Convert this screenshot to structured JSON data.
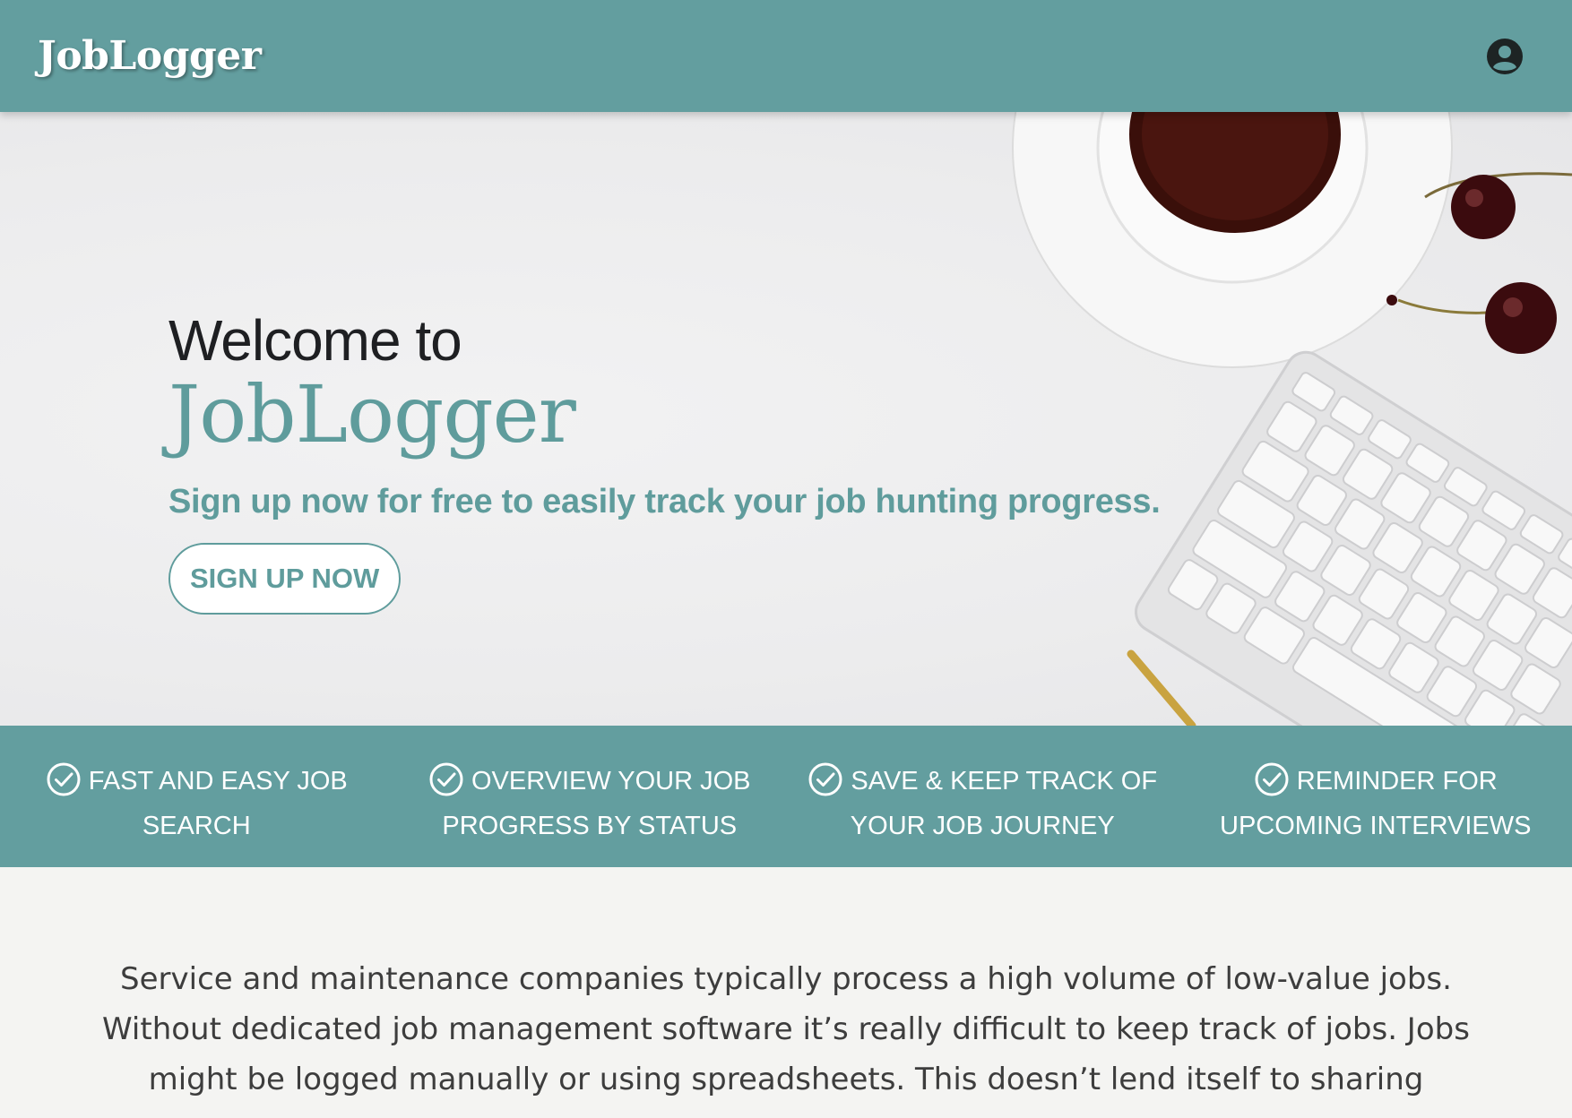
{
  "header": {
    "brand": "JobLogger",
    "account_icon": "account-circle-icon"
  },
  "hero": {
    "welcome": "Welcome to",
    "brand": "JobLogger",
    "tagline": "Sign up now for free to easily track your job hunting progress.",
    "signup_label": "SIGN UP NOW"
  },
  "features": [
    {
      "line1": "FAST AND EASY JOB",
      "line2": "SEARCH",
      "icon": "check-circle-icon"
    },
    {
      "line1": "OVERVIEW YOUR JOB",
      "line2": "PROGRESS BY STATUS",
      "icon": "check-circle-icon"
    },
    {
      "line1": "SAVE & KEEP TRACK OF",
      "line2": "YOUR JOB JOURNEY",
      "icon": "check-circle-icon"
    },
    {
      "line1": "REMINDER FOR",
      "line2": "UPCOMING INTERVIEWS",
      "icon": "check-circle-icon"
    }
  ],
  "intro": {
    "line1": "Service and maintenance companies typically process a high volume of low-value jobs.",
    "line2": "Without dedicated job management software it’s really difficult to keep track of jobs. Jobs",
    "line3": "might be logged manually or using spreadsheets. This doesn’t lend itself to sharing"
  },
  "colors": {
    "brand": "#639e9f",
    "accent_text": "#5f9c9c",
    "dark_text": "#1e1f22"
  }
}
